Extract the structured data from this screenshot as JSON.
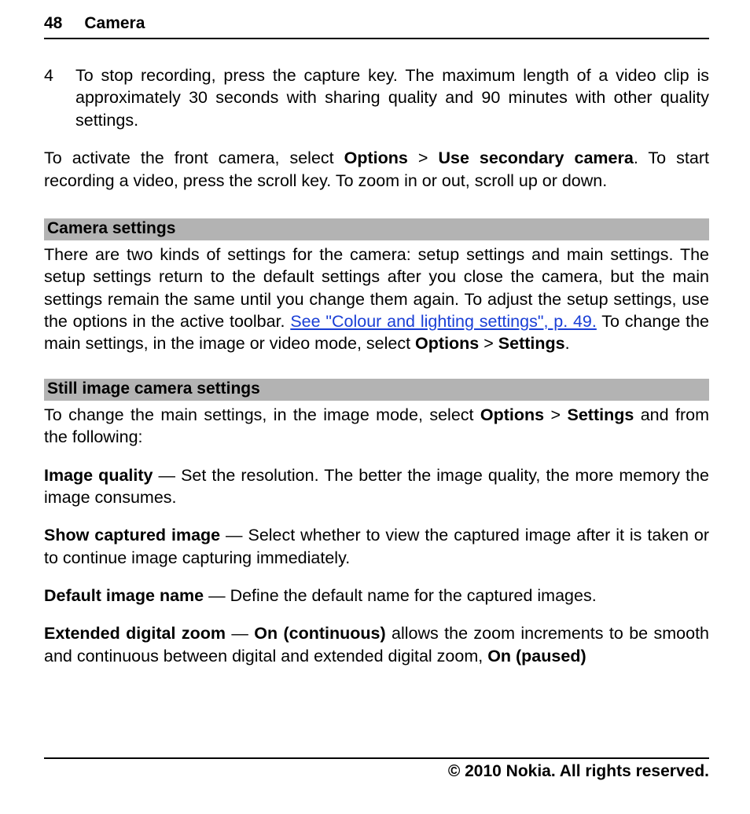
{
  "header": {
    "page_number": "48",
    "title": "Camera"
  },
  "step4": {
    "index": "4",
    "text": "To stop recording, press the capture key.  The maximum length of a video clip is approximately 30 seconds with sharing quality and 90 minutes with other quality settings."
  },
  "front_camera": {
    "pre": "To activate the front camera, select ",
    "options": "Options",
    "gt": " > ",
    "use_secondary": "Use secondary camera",
    "post": ". To start recording a video, press the scroll key. To zoom in or out, scroll up or down."
  },
  "section_camera_settings": {
    "heading": "Camera settings",
    "p1_a": "There are two kinds of settings for the camera: setup settings and main settings. The setup settings return to the default settings after you close the camera, but the main settings remain the same until you change them again. To adjust the setup settings, use the options in the active toolbar. ",
    "p1_link": "See \"Colour and lighting settings\", p. 49.",
    "p1_b": " To change the main settings, in the image or video mode, select ",
    "p1_options": "Options",
    "p1_gt": " > ",
    "p1_settings": "Settings",
    "p1_end": "."
  },
  "section_still": {
    "heading": "Still image camera settings",
    "intro_a": "To change the main settings, in the image mode, select ",
    "intro_options": "Options",
    "intro_gt": " > ",
    "intro_settings": "Settings",
    "intro_b": " and from the following:",
    "image_quality": {
      "label": "Image quality",
      "text": "  — Set the resolution. The better the image quality, the more memory the image consumes."
    },
    "show_captured": {
      "label": "Show captured image",
      "text": "  — Select whether to view the captured image after it is taken or to continue image capturing immediately."
    },
    "default_name": {
      "label": "Default image name",
      "text": "  — Define the default name for the captured images."
    },
    "ext_zoom": {
      "label": "Extended digital zoom",
      "dash": "  — ",
      "on_cont": "On (continuous)",
      "mid": " allows the zoom increments to be smooth and continuous between digital and extended digital zoom, ",
      "on_paused": "On (paused)"
    }
  },
  "footer": "© 2010 Nokia. All rights reserved."
}
